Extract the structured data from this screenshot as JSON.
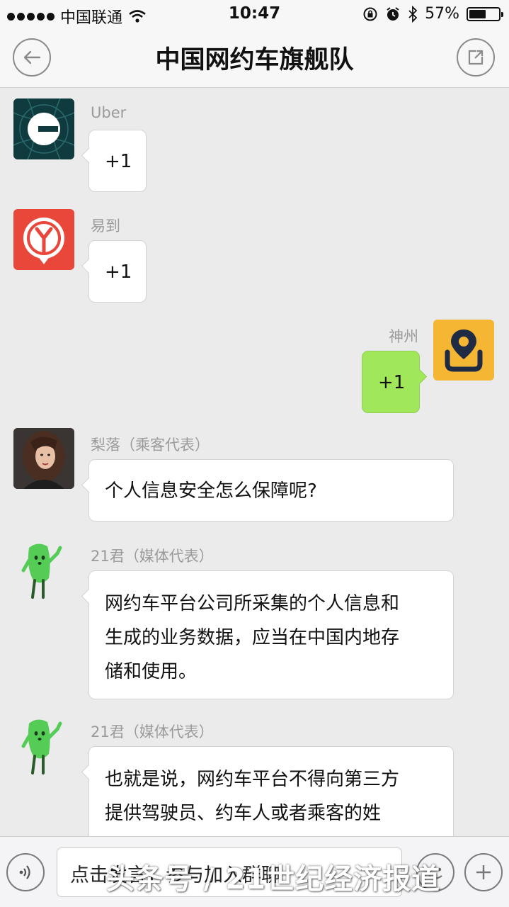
{
  "status_bar": {
    "carrier": "中国联通",
    "time": "10:47",
    "battery": "57%",
    "battery_level": 0.57
  },
  "header": {
    "title": "中国网约车旗舰队"
  },
  "messages": [
    {
      "sender": "Uber",
      "text": "+1",
      "side": "left",
      "avatar": "uber-logo"
    },
    {
      "sender": "易到",
      "text": "+1",
      "side": "left",
      "avatar": "yidao-logo"
    },
    {
      "sender": "神州",
      "text": "+1",
      "side": "right",
      "avatar": "shenzhou-logo"
    },
    {
      "sender": "梨落（乘客代表）",
      "text": "个人信息安全怎么保障呢?",
      "side": "left",
      "avatar": "woman-photo"
    },
    {
      "sender": "21君（媒体代表）",
      "lines": [
        "网约车平台公司所采集的个人信息和",
        "生成的业务数据，应当在中国内地存",
        "储和使用。"
      ],
      "side": "left",
      "avatar": "green-mascot"
    },
    {
      "sender": "21君（媒体代表）",
      "lines": [
        "也就是说，网约车平台不得向第三方",
        "提供驾驶员、约车人或者乘客的姓"
      ],
      "side": "left",
      "avatar": "green-mascot"
    }
  ],
  "input_bar": {
    "text": "点击发言，参与加入群聊"
  },
  "watermark": "头条号 / 21世纪经济报道",
  "colors": {
    "background": "#ebebeb",
    "bubble_self": "#a0e75a",
    "bubble_other": "#ffffff",
    "uber": "#0f3a3e",
    "yidao": "#e8473a",
    "shenzhou": "#f4b633",
    "mascot": "#55cc55"
  }
}
